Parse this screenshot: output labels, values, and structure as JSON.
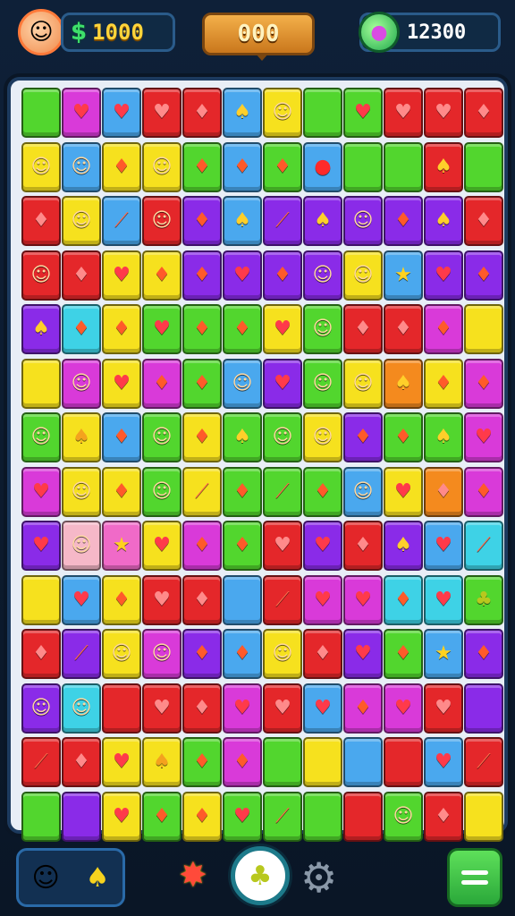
{
  "hud": {
    "coins": "1000",
    "score": "000",
    "gems": "12300"
  },
  "colors": {
    "green": "#52d62e",
    "magenta": "#d93ad9",
    "blue": "#4aa8ee",
    "red": "#e4272a",
    "yellow": "#f6e11e",
    "purple": "#8a2be8",
    "orange": "#f48a1e",
    "pink": "#f06ac8",
    "cyan": "#3ed2e6",
    "lightpink": "#f6b8c8"
  },
  "icons": {
    "heart": "♥",
    "diamond": "♦",
    "drop": "●",
    "face": "☺",
    "star": "★",
    "blank": "",
    "sword": "⟋",
    "bell": "♠",
    "leaf": "♣"
  },
  "board": [
    [
      "green:blank",
      "magenta:heart",
      "blue:heart",
      "red:heart",
      "red:diamond",
      "blue:bell",
      "yellow:face",
      "green:blank",
      "green:heart",
      "red:heart",
      "red:heart",
      "red:diamond"
    ],
    [
      "yellow:face",
      "blue:face",
      "yellow:diamond",
      "yellow:face",
      "green:diamond",
      "blue:diamond",
      "green:diamond",
      "blue:drop",
      "green:blank",
      "green:blank",
      "red:bell",
      "green:blank"
    ],
    [
      "red:diamond",
      "yellow:face",
      "blue:sword",
      "red:face",
      "purple:diamond",
      "blue:bell",
      "purple:sword",
      "purple:bell",
      "purple:face",
      "purple:diamond",
      "purple:bell",
      "red:diamond"
    ],
    [
      "red:face",
      "red:diamond",
      "yellow:heart",
      "yellow:diamond",
      "purple:diamond",
      "purple:heart",
      "purple:diamond",
      "purple:face",
      "yellow:face",
      "blue:star",
      "purple:heart",
      "purple:diamond"
    ],
    [
      "purple:bell",
      "cyan:diamond",
      "yellow:diamond",
      "green:heart",
      "green:diamond",
      "green:diamond",
      "yellow:heart",
      "green:face",
      "red:diamond",
      "red:diamond",
      "magenta:diamond",
      "yellow:blank"
    ],
    [
      "yellow:blank",
      "magenta:face",
      "yellow:heart",
      "magenta:diamond",
      "green:diamond",
      "blue:face",
      "purple:heart",
      "green:face",
      "yellow:face",
      "orange:bell",
      "yellow:diamond",
      "magenta:diamond"
    ],
    [
      "green:face",
      "yellow:bell",
      "blue:diamond",
      "green:face",
      "yellow:diamond",
      "green:bell",
      "green:face",
      "yellow:face",
      "purple:diamond",
      "green:diamond",
      "green:bell",
      "magenta:heart"
    ],
    [
      "magenta:heart",
      "yellow:face",
      "yellow:diamond",
      "green:face",
      "yellow:sword",
      "green:diamond",
      "green:sword",
      "green:diamond",
      "blue:face",
      "yellow:heart",
      "orange:diamond",
      "magenta:diamond"
    ],
    [
      "purple:heart",
      "lightpink:face",
      "pink:star",
      "yellow:heart",
      "magenta:diamond",
      "green:diamond",
      "red:heart",
      "purple:heart",
      "red:diamond",
      "purple:bell",
      "blue:heart",
      "cyan:sword"
    ],
    [
      "yellow:blank",
      "blue:heart",
      "yellow:diamond",
      "red:heart",
      "red:diamond",
      "blue:blank",
      "red:sword",
      "magenta:heart",
      "magenta:heart",
      "cyan:diamond",
      "cyan:heart",
      "green:leaf"
    ],
    [
      "red:diamond",
      "purple:sword",
      "yellow:face",
      "magenta:face",
      "purple:diamond",
      "blue:diamond",
      "yellow:face",
      "red:diamond",
      "purple:heart",
      "green:diamond",
      "blue:star",
      "purple:diamond"
    ],
    [
      "purple:face",
      "cyan:face",
      "red:blank",
      "red:heart",
      "red:diamond",
      "magenta:heart",
      "red:heart",
      "blue:heart",
      "magenta:diamond",
      "magenta:heart",
      "red:heart",
      "purple:blank"
    ],
    [
      "red:sword",
      "red:diamond",
      "yellow:heart",
      "yellow:bell",
      "green:diamond",
      "magenta:diamond",
      "green:blank",
      "yellow:blank",
      "blue:blank",
      "red:blank",
      "blue:heart",
      "red:sword"
    ],
    [
      "green:blank",
      "purple:blank",
      "yellow:heart",
      "green:diamond",
      "yellow:diamond",
      "green:heart",
      "green:sword",
      "green:blank",
      "red:blank",
      "green:face",
      "red:diamond",
      "yellow:blank"
    ]
  ],
  "bottom": {
    "left_icons": [
      "face",
      "bell"
    ]
  }
}
